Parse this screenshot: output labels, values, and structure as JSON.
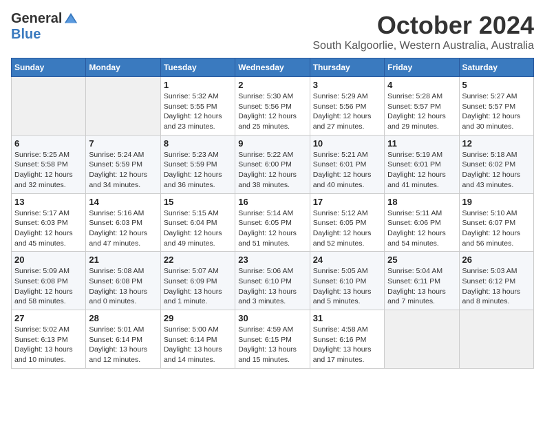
{
  "header": {
    "logo_general": "General",
    "logo_blue": "Blue",
    "month_title": "October 2024",
    "location": "South Kalgoorlie, Western Australia, Australia"
  },
  "days_of_week": [
    "Sunday",
    "Monday",
    "Tuesday",
    "Wednesday",
    "Thursday",
    "Friday",
    "Saturday"
  ],
  "weeks": [
    [
      {
        "day": "",
        "info": ""
      },
      {
        "day": "",
        "info": ""
      },
      {
        "day": "1",
        "info": "Sunrise: 5:32 AM\nSunset: 5:55 PM\nDaylight: 12 hours and 23 minutes."
      },
      {
        "day": "2",
        "info": "Sunrise: 5:30 AM\nSunset: 5:56 PM\nDaylight: 12 hours and 25 minutes."
      },
      {
        "day": "3",
        "info": "Sunrise: 5:29 AM\nSunset: 5:56 PM\nDaylight: 12 hours and 27 minutes."
      },
      {
        "day": "4",
        "info": "Sunrise: 5:28 AM\nSunset: 5:57 PM\nDaylight: 12 hours and 29 minutes."
      },
      {
        "day": "5",
        "info": "Sunrise: 5:27 AM\nSunset: 5:57 PM\nDaylight: 12 hours and 30 minutes."
      }
    ],
    [
      {
        "day": "6",
        "info": "Sunrise: 5:25 AM\nSunset: 5:58 PM\nDaylight: 12 hours and 32 minutes."
      },
      {
        "day": "7",
        "info": "Sunrise: 5:24 AM\nSunset: 5:59 PM\nDaylight: 12 hours and 34 minutes."
      },
      {
        "day": "8",
        "info": "Sunrise: 5:23 AM\nSunset: 5:59 PM\nDaylight: 12 hours and 36 minutes."
      },
      {
        "day": "9",
        "info": "Sunrise: 5:22 AM\nSunset: 6:00 PM\nDaylight: 12 hours and 38 minutes."
      },
      {
        "day": "10",
        "info": "Sunrise: 5:21 AM\nSunset: 6:01 PM\nDaylight: 12 hours and 40 minutes."
      },
      {
        "day": "11",
        "info": "Sunrise: 5:19 AM\nSunset: 6:01 PM\nDaylight: 12 hours and 41 minutes."
      },
      {
        "day": "12",
        "info": "Sunrise: 5:18 AM\nSunset: 6:02 PM\nDaylight: 12 hours and 43 minutes."
      }
    ],
    [
      {
        "day": "13",
        "info": "Sunrise: 5:17 AM\nSunset: 6:03 PM\nDaylight: 12 hours and 45 minutes."
      },
      {
        "day": "14",
        "info": "Sunrise: 5:16 AM\nSunset: 6:03 PM\nDaylight: 12 hours and 47 minutes."
      },
      {
        "day": "15",
        "info": "Sunrise: 5:15 AM\nSunset: 6:04 PM\nDaylight: 12 hours and 49 minutes."
      },
      {
        "day": "16",
        "info": "Sunrise: 5:14 AM\nSunset: 6:05 PM\nDaylight: 12 hours and 51 minutes."
      },
      {
        "day": "17",
        "info": "Sunrise: 5:12 AM\nSunset: 6:05 PM\nDaylight: 12 hours and 52 minutes."
      },
      {
        "day": "18",
        "info": "Sunrise: 5:11 AM\nSunset: 6:06 PM\nDaylight: 12 hours and 54 minutes."
      },
      {
        "day": "19",
        "info": "Sunrise: 5:10 AM\nSunset: 6:07 PM\nDaylight: 12 hours and 56 minutes."
      }
    ],
    [
      {
        "day": "20",
        "info": "Sunrise: 5:09 AM\nSunset: 6:08 PM\nDaylight: 12 hours and 58 minutes."
      },
      {
        "day": "21",
        "info": "Sunrise: 5:08 AM\nSunset: 6:08 PM\nDaylight: 13 hours and 0 minutes."
      },
      {
        "day": "22",
        "info": "Sunrise: 5:07 AM\nSunset: 6:09 PM\nDaylight: 13 hours and 1 minute."
      },
      {
        "day": "23",
        "info": "Sunrise: 5:06 AM\nSunset: 6:10 PM\nDaylight: 13 hours and 3 minutes."
      },
      {
        "day": "24",
        "info": "Sunrise: 5:05 AM\nSunset: 6:10 PM\nDaylight: 13 hours and 5 minutes."
      },
      {
        "day": "25",
        "info": "Sunrise: 5:04 AM\nSunset: 6:11 PM\nDaylight: 13 hours and 7 minutes."
      },
      {
        "day": "26",
        "info": "Sunrise: 5:03 AM\nSunset: 6:12 PM\nDaylight: 13 hours and 8 minutes."
      }
    ],
    [
      {
        "day": "27",
        "info": "Sunrise: 5:02 AM\nSunset: 6:13 PM\nDaylight: 13 hours and 10 minutes."
      },
      {
        "day": "28",
        "info": "Sunrise: 5:01 AM\nSunset: 6:14 PM\nDaylight: 13 hours and 12 minutes."
      },
      {
        "day": "29",
        "info": "Sunrise: 5:00 AM\nSunset: 6:14 PM\nDaylight: 13 hours and 14 minutes."
      },
      {
        "day": "30",
        "info": "Sunrise: 4:59 AM\nSunset: 6:15 PM\nDaylight: 13 hours and 15 minutes."
      },
      {
        "day": "31",
        "info": "Sunrise: 4:58 AM\nSunset: 6:16 PM\nDaylight: 13 hours and 17 minutes."
      },
      {
        "day": "",
        "info": ""
      },
      {
        "day": "",
        "info": ""
      }
    ]
  ]
}
